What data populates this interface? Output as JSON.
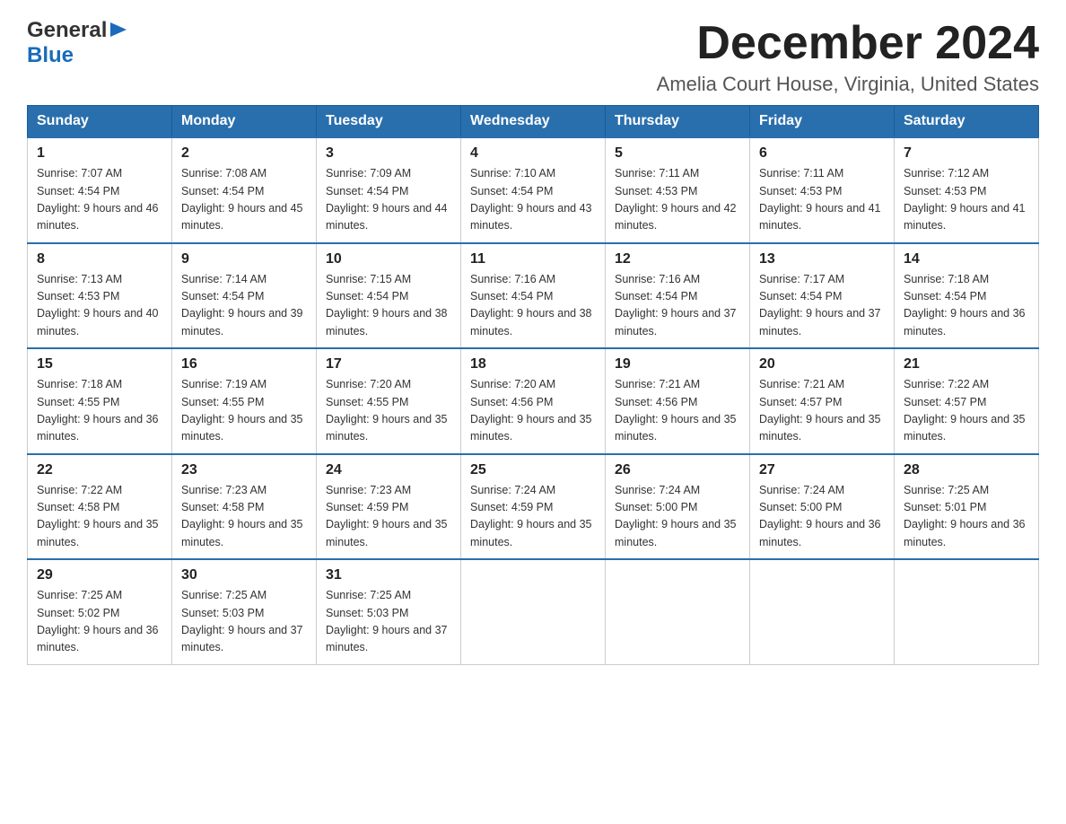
{
  "logo": {
    "general": "General",
    "blue": "Blue",
    "arrow": "▶"
  },
  "header": {
    "month_year": "December 2024",
    "location": "Amelia Court House, Virginia, United States"
  },
  "weekdays": [
    "Sunday",
    "Monday",
    "Tuesday",
    "Wednesday",
    "Thursday",
    "Friday",
    "Saturday"
  ],
  "weeks": [
    [
      {
        "day": "1",
        "sunrise": "7:07 AM",
        "sunset": "4:54 PM",
        "daylight": "9 hours and 46 minutes."
      },
      {
        "day": "2",
        "sunrise": "7:08 AM",
        "sunset": "4:54 PM",
        "daylight": "9 hours and 45 minutes."
      },
      {
        "day": "3",
        "sunrise": "7:09 AM",
        "sunset": "4:54 PM",
        "daylight": "9 hours and 44 minutes."
      },
      {
        "day": "4",
        "sunrise": "7:10 AM",
        "sunset": "4:54 PM",
        "daylight": "9 hours and 43 minutes."
      },
      {
        "day": "5",
        "sunrise": "7:11 AM",
        "sunset": "4:53 PM",
        "daylight": "9 hours and 42 minutes."
      },
      {
        "day": "6",
        "sunrise": "7:11 AM",
        "sunset": "4:53 PM",
        "daylight": "9 hours and 41 minutes."
      },
      {
        "day": "7",
        "sunrise": "7:12 AM",
        "sunset": "4:53 PM",
        "daylight": "9 hours and 41 minutes."
      }
    ],
    [
      {
        "day": "8",
        "sunrise": "7:13 AM",
        "sunset": "4:53 PM",
        "daylight": "9 hours and 40 minutes."
      },
      {
        "day": "9",
        "sunrise": "7:14 AM",
        "sunset": "4:54 PM",
        "daylight": "9 hours and 39 minutes."
      },
      {
        "day": "10",
        "sunrise": "7:15 AM",
        "sunset": "4:54 PM",
        "daylight": "9 hours and 38 minutes."
      },
      {
        "day": "11",
        "sunrise": "7:16 AM",
        "sunset": "4:54 PM",
        "daylight": "9 hours and 38 minutes."
      },
      {
        "day": "12",
        "sunrise": "7:16 AM",
        "sunset": "4:54 PM",
        "daylight": "9 hours and 37 minutes."
      },
      {
        "day": "13",
        "sunrise": "7:17 AM",
        "sunset": "4:54 PM",
        "daylight": "9 hours and 37 minutes."
      },
      {
        "day": "14",
        "sunrise": "7:18 AM",
        "sunset": "4:54 PM",
        "daylight": "9 hours and 36 minutes."
      }
    ],
    [
      {
        "day": "15",
        "sunrise": "7:18 AM",
        "sunset": "4:55 PM",
        "daylight": "9 hours and 36 minutes."
      },
      {
        "day": "16",
        "sunrise": "7:19 AM",
        "sunset": "4:55 PM",
        "daylight": "9 hours and 35 minutes."
      },
      {
        "day": "17",
        "sunrise": "7:20 AM",
        "sunset": "4:55 PM",
        "daylight": "9 hours and 35 minutes."
      },
      {
        "day": "18",
        "sunrise": "7:20 AM",
        "sunset": "4:56 PM",
        "daylight": "9 hours and 35 minutes."
      },
      {
        "day": "19",
        "sunrise": "7:21 AM",
        "sunset": "4:56 PM",
        "daylight": "9 hours and 35 minutes."
      },
      {
        "day": "20",
        "sunrise": "7:21 AM",
        "sunset": "4:57 PM",
        "daylight": "9 hours and 35 minutes."
      },
      {
        "day": "21",
        "sunrise": "7:22 AM",
        "sunset": "4:57 PM",
        "daylight": "9 hours and 35 minutes."
      }
    ],
    [
      {
        "day": "22",
        "sunrise": "7:22 AM",
        "sunset": "4:58 PM",
        "daylight": "9 hours and 35 minutes."
      },
      {
        "day": "23",
        "sunrise": "7:23 AM",
        "sunset": "4:58 PM",
        "daylight": "9 hours and 35 minutes."
      },
      {
        "day": "24",
        "sunrise": "7:23 AM",
        "sunset": "4:59 PM",
        "daylight": "9 hours and 35 minutes."
      },
      {
        "day": "25",
        "sunrise": "7:24 AM",
        "sunset": "4:59 PM",
        "daylight": "9 hours and 35 minutes."
      },
      {
        "day": "26",
        "sunrise": "7:24 AM",
        "sunset": "5:00 PM",
        "daylight": "9 hours and 35 minutes."
      },
      {
        "day": "27",
        "sunrise": "7:24 AM",
        "sunset": "5:00 PM",
        "daylight": "9 hours and 36 minutes."
      },
      {
        "day": "28",
        "sunrise": "7:25 AM",
        "sunset": "5:01 PM",
        "daylight": "9 hours and 36 minutes."
      }
    ],
    [
      {
        "day": "29",
        "sunrise": "7:25 AM",
        "sunset": "5:02 PM",
        "daylight": "9 hours and 36 minutes."
      },
      {
        "day": "30",
        "sunrise": "7:25 AM",
        "sunset": "5:03 PM",
        "daylight": "9 hours and 37 minutes."
      },
      {
        "day": "31",
        "sunrise": "7:25 AM",
        "sunset": "5:03 PM",
        "daylight": "9 hours and 37 minutes."
      },
      null,
      null,
      null,
      null
    ]
  ]
}
